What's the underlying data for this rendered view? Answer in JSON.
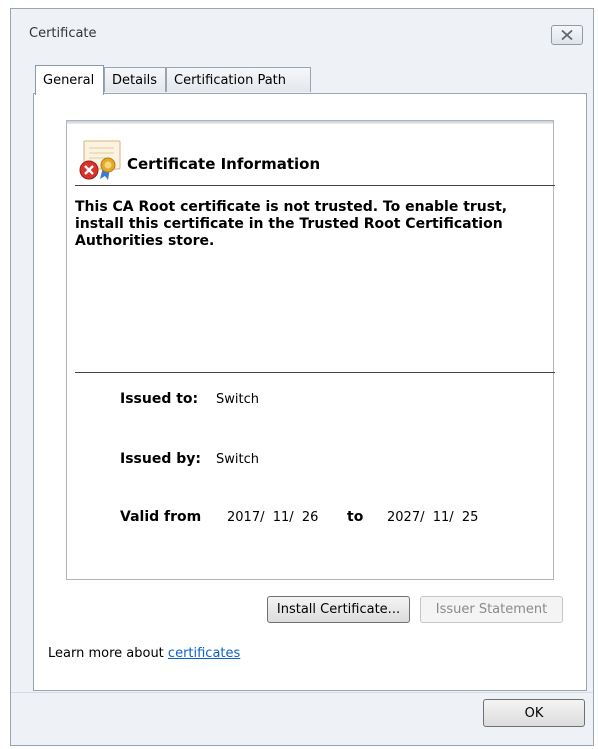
{
  "window": {
    "title": "Certificate",
    "close_icon": "close-icon"
  },
  "tabs": [
    {
      "label": "General",
      "active": true
    },
    {
      "label": "Details",
      "active": false
    },
    {
      "label": "Certification Path",
      "active": false
    }
  ],
  "info": {
    "icon": "certificate-error-icon",
    "heading": "Certificate Information",
    "warning": "This CA Root certificate is not trusted. To enable trust, install this certificate in the Trusted Root Certification Authorities store.",
    "issued_to_label": "Issued to:",
    "issued_to_value": "Switch",
    "issued_by_label": "Issued by:",
    "issued_by_value": "Switch",
    "valid_from_label": "Valid from",
    "valid_from_value": "2017/  11/  26",
    "to_label": "to",
    "valid_to_value": "2027/  11/  25"
  },
  "buttons": {
    "install": "Install Certificate...",
    "issuer_statement": "Issuer Statement",
    "ok": "OK"
  },
  "learn_more": {
    "prefix": "Learn more about ",
    "link": "certificates"
  },
  "colors": {
    "window_bg": "#eef1f5",
    "link": "#0b63c8",
    "error_red": "#d9312b",
    "ribbon_gold": "#e5a92a"
  }
}
